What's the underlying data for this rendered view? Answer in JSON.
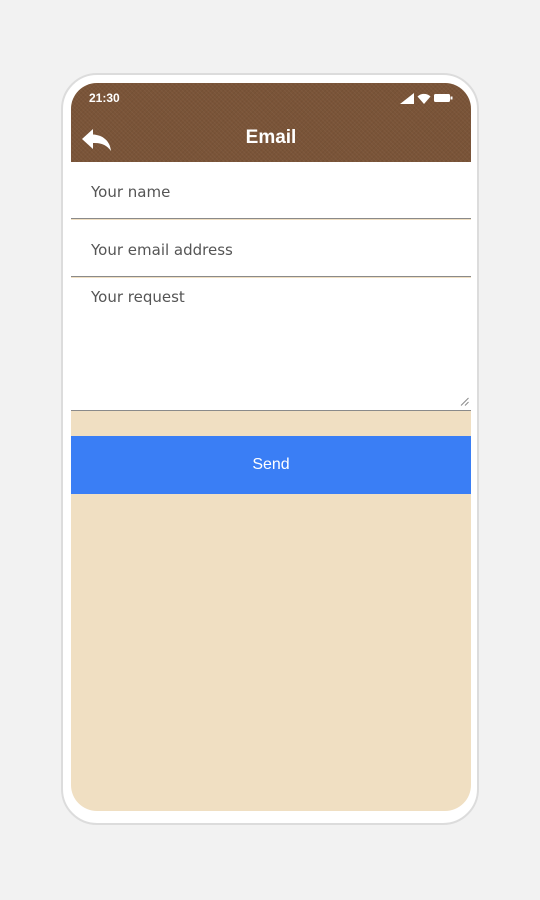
{
  "status_bar": {
    "time": "21:30",
    "icons": [
      "signal-icon",
      "wifi-icon",
      "battery-icon"
    ]
  },
  "header": {
    "title": "Email",
    "back_icon": "reply-arrow-icon"
  },
  "form": {
    "name_placeholder": "Your name",
    "email_placeholder": "Your email address",
    "request_placeholder": "Your request"
  },
  "actions": {
    "send_label": "Send"
  },
  "colors": {
    "header": "#7a5438",
    "background": "#f0dfc2",
    "send_button": "#3a7ef5"
  }
}
